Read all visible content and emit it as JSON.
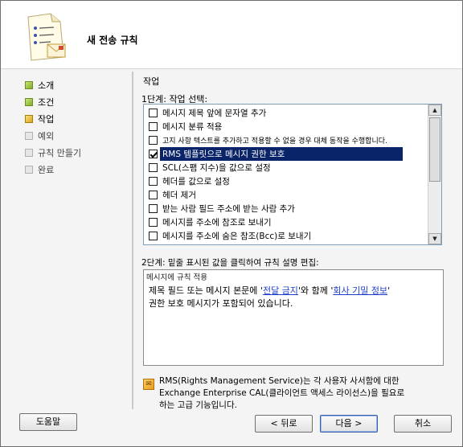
{
  "header": {
    "title": "새 전송 규칙",
    "icon": "document-mail-icon"
  },
  "steps": [
    {
      "label": "소개",
      "state": "done"
    },
    {
      "label": "조건",
      "state": "done"
    },
    {
      "label": "작업",
      "state": "current"
    },
    {
      "label": "예외",
      "state": "pending"
    },
    {
      "label": "규칙 만들기",
      "state": "pending"
    },
    {
      "label": "완료",
      "state": "pending"
    }
  ],
  "main": {
    "section_title": "작업",
    "step1_label": "1단계: 작업 선택:",
    "actions": [
      {
        "label": "메시지 제목 앞에 문자열 추가",
        "checked": false
      },
      {
        "label": "메시지 분류 적용",
        "checked": false
      },
      {
        "label": "고지 사항 텍스트를 추가하고 적용할 수 없을 경우 대체 동작을 수행합니다.",
        "checked": false
      },
      {
        "label": "RMS 템플릿으로 메시지 권한 보호",
        "checked": true
      },
      {
        "label": "SCL(스팸 지수)을 값으로 설정",
        "checked": false
      },
      {
        "label": "헤더를 값으로 설정",
        "checked": false
      },
      {
        "label": "헤더 제거",
        "checked": false
      },
      {
        "label": "받는 사람 필드 주소에 받는 사람 추가",
        "checked": false
      },
      {
        "label": "메시지를 주소에 참조로 보내기",
        "checked": false
      },
      {
        "label": "메시지를 주소에 숨은 참조(Bcc)로 보내기",
        "checked": false
      }
    ],
    "step2_label": "2단계: 밑줄 표시된 값을 클릭하여 규칙 설명 편집:",
    "description": {
      "heading": "메시지에 규칙 적용",
      "line1_prefix": "제목 필드 또는 메시지 본문에 '",
      "link1": "전달 금지",
      "line1_mid": "'와 함께 '",
      "link2": "회사 기밀 정보",
      "line1_suffix": "'",
      "line2": "권한 보호 메시지가 포함되어 있습니다."
    },
    "info": {
      "line1": "RMS(Rights Management Service)는 각 사용자 사서함에 대한",
      "line2": "Exchange Enterprise CAL(클라이언트 액세스 라이선스)을 필요로",
      "line3": "하는 고급 기능입니다."
    }
  },
  "footer": {
    "help": "도움말",
    "back": "< 뒤로",
    "next": "다음 >",
    "cancel": "취소"
  }
}
